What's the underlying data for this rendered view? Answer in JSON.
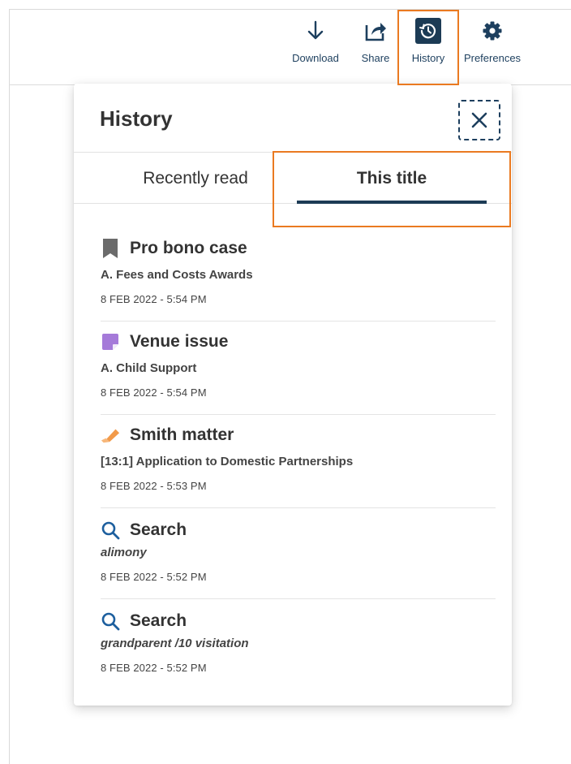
{
  "toolbar": {
    "download_label": "Download",
    "share_label": "Share",
    "history_label": "History",
    "preferences_label": "Preferences"
  },
  "panel": {
    "title": "History",
    "tabs": [
      {
        "label": "Recently read",
        "active": false
      },
      {
        "label": "This title",
        "active": true
      }
    ]
  },
  "items": [
    {
      "icon": "bookmark-icon",
      "title": "Pro bono case",
      "subtitle": "A. Fees and Costs Awards",
      "time": "8 FEB 2022 - 5:54 PM"
    },
    {
      "icon": "note-icon",
      "title": "Venue issue",
      "subtitle": "A. Child Support",
      "time": "8 FEB 2022 - 5:54 PM"
    },
    {
      "icon": "highlighter-icon",
      "title": "Smith matter",
      "subtitle": "[13:1] Application to Domestic Partnerships",
      "time": "8 FEB 2022 - 5:53 PM"
    },
    {
      "icon": "search-icon",
      "title": "Search",
      "subtitle": "alimony",
      "time": "8 FEB 2022 - 5:52 PM"
    },
    {
      "icon": "search-icon",
      "title": "Search",
      "subtitle": "grandparent /10 visitation",
      "time": "8 FEB 2022 - 5:52 PM"
    }
  ],
  "colors": {
    "primary": "#1c3b55",
    "highlight_outline": "#ea7a21",
    "bookmark": "#6b6b6b",
    "note": "#a57ad9",
    "highlighter": "#f29a4a"
  }
}
